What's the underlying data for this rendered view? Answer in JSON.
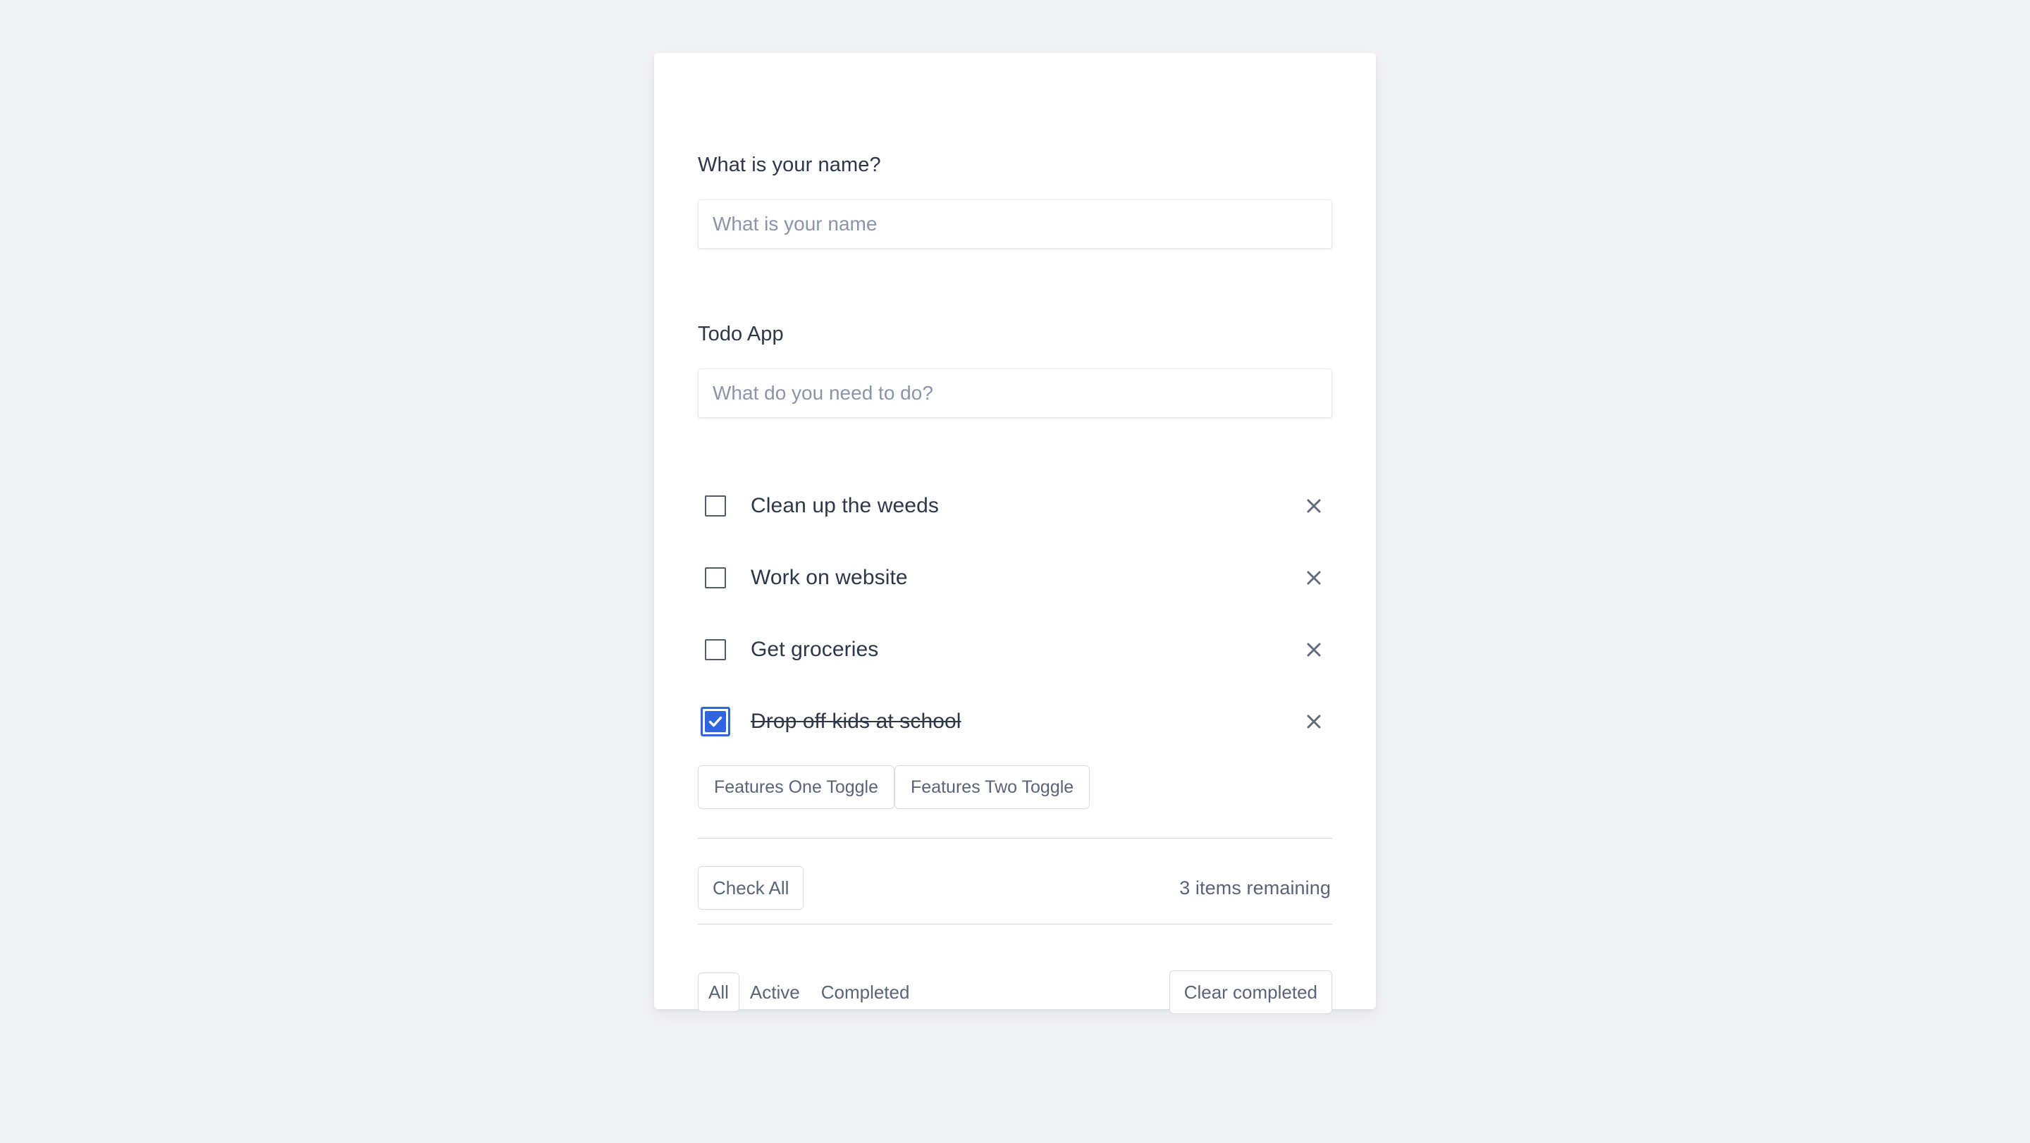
{
  "app": {
    "background_color": "#f1f2f4",
    "card_background": "#ffffff",
    "accent_color": "#2f66e0",
    "text_color": "#2d3748",
    "muted_text_color": "#5a6476"
  },
  "name_field": {
    "label": "What is your name?",
    "value": "",
    "placeholder": "What is your name"
  },
  "todo_field": {
    "label": "Todo App",
    "value": "",
    "placeholder": "What do you need to do?"
  },
  "todos": [
    {
      "text": "Clean up the weeds",
      "done": false,
      "delete_icon": "close-icon"
    },
    {
      "text": "Work on website",
      "done": false,
      "delete_icon": "close-icon"
    },
    {
      "text": "Get groceries",
      "done": false,
      "delete_icon": "close-icon"
    },
    {
      "text": "Drop off kids at school",
      "done": true,
      "delete_icon": "close-icon"
    }
  ],
  "feature_toggles": [
    {
      "label": "Features One Toggle"
    },
    {
      "label": "Features Two Toggle"
    }
  ],
  "actions": {
    "check_all_label": "Check All",
    "remaining_text": "3 items remaining",
    "clear_completed_label": "Clear completed"
  },
  "filters": [
    {
      "label": "All",
      "active": true
    },
    {
      "label": "Active",
      "active": false
    },
    {
      "label": "Completed",
      "active": false
    }
  ]
}
